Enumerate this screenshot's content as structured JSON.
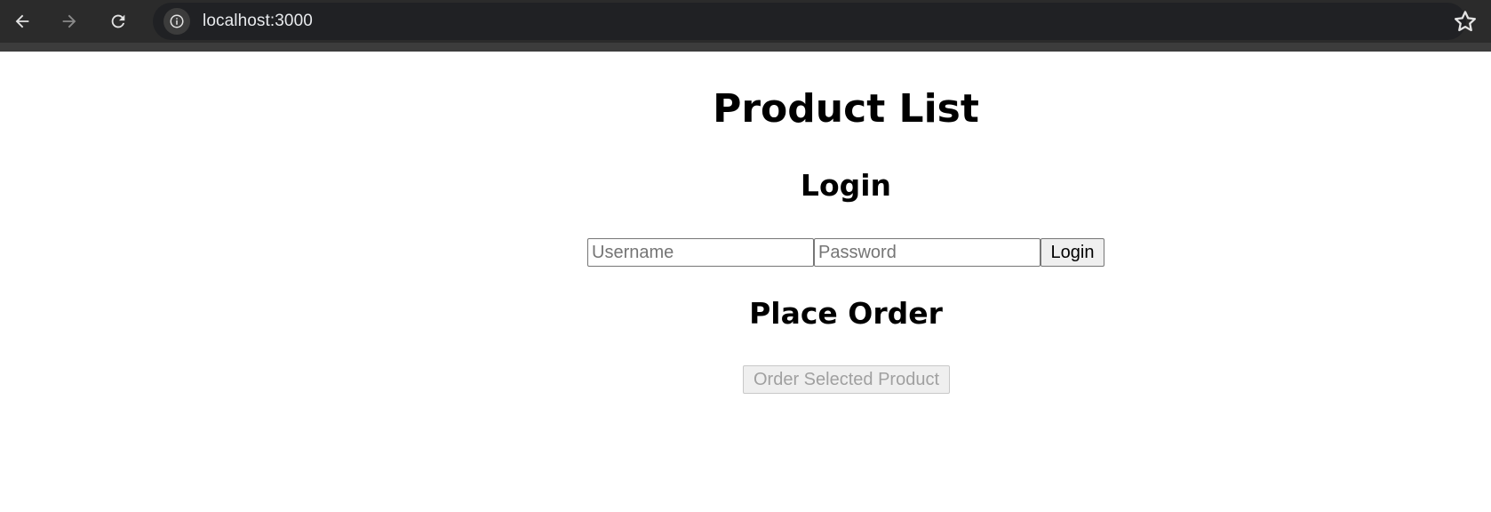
{
  "browser": {
    "url": "localhost:3000",
    "back_icon": "arrow-left-icon",
    "forward_icon": "arrow-right-icon",
    "reload_icon": "reload-icon",
    "site_info_icon": "info-icon",
    "bookmark_icon": "star-icon",
    "forward_enabled": false
  },
  "page": {
    "title": "Product List",
    "login": {
      "heading": "Login",
      "username_placeholder": "Username",
      "password_placeholder": "Password",
      "username_value": "",
      "password_value": "",
      "submit_label": "Login"
    },
    "order": {
      "heading": "Place Order",
      "button_label": "Order Selected Product",
      "button_disabled": true
    }
  }
}
